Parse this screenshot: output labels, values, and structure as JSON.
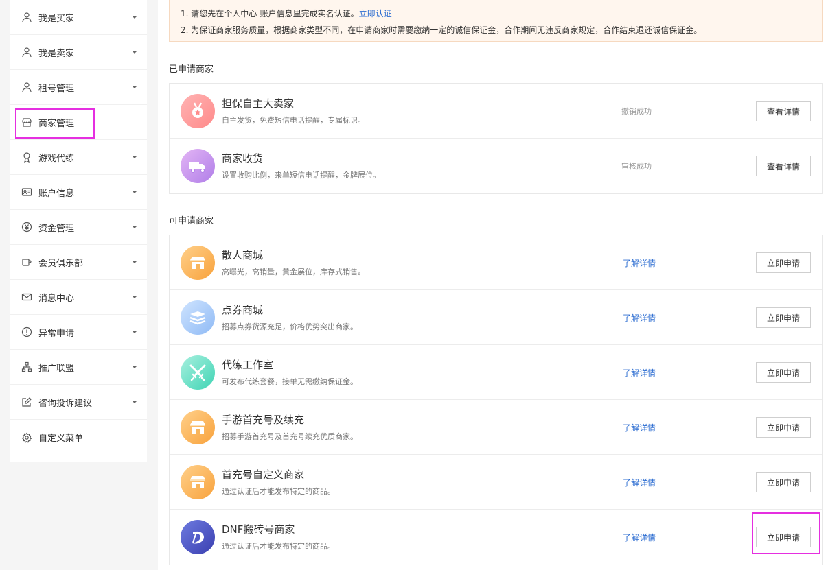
{
  "sidebar": {
    "items": [
      {
        "label": "我是买家",
        "icon": "user-icon",
        "caret": true
      },
      {
        "label": "我是卖家",
        "icon": "user-icon",
        "caret": true
      },
      {
        "label": "租号管理",
        "icon": "user-icon",
        "caret": true
      },
      {
        "label": "商家管理",
        "icon": "store-icon",
        "caret": false
      },
      {
        "label": "游戏代练",
        "icon": "trophy-icon",
        "caret": true
      },
      {
        "label": "账户信息",
        "icon": "id-card-icon",
        "caret": true
      },
      {
        "label": "资金管理",
        "icon": "yen-icon",
        "caret": true
      },
      {
        "label": "会员俱乐部",
        "icon": "cup-icon",
        "caret": true
      },
      {
        "label": "消息中心",
        "icon": "mail-icon",
        "caret": true
      },
      {
        "label": "异常申请",
        "icon": "alert-icon",
        "caret": true
      },
      {
        "label": "推广联盟",
        "icon": "org-chart-icon",
        "caret": true
      },
      {
        "label": "咨询投诉建议",
        "icon": "edit-icon",
        "caret": true
      },
      {
        "label": "自定义菜单",
        "icon": "gear-icon",
        "caret": false
      }
    ]
  },
  "notice": {
    "line1_text": "1. 请您先在个人中心-账户信息里完成实名认证。",
    "line1_link": "立即认证",
    "line2_text": "2. 为保证商家服务质量，根据商家类型不同，在申请商家时需要缴纳一定的诚信保证金，合作期间无违反商家规定，合作结束退还诚信保证金。"
  },
  "applied": {
    "title": "已申请商家",
    "items": [
      {
        "name": "担保自主大卖家",
        "desc": "自主发货，免费短信电话提醒，专属标识。",
        "status": "撤销成功",
        "button": "查看详情",
        "icon": "medal-icon"
      },
      {
        "name": "商家收货",
        "desc": "设置收购比例，来单短信电话提醒，金牌展位。",
        "status": "审核成功",
        "button": "查看详情",
        "icon": "truck-icon"
      }
    ]
  },
  "available": {
    "title": "可申请商家",
    "items": [
      {
        "name": "散人商城",
        "desc": "高曝光，高销量，黄金展位，库存式销售。",
        "link": "了解详情",
        "button": "立即申请",
        "icon": "shop-icon"
      },
      {
        "name": "点券商城",
        "desc": "招募点券货源充足，价格优势突出商家。",
        "link": "了解详情",
        "button": "立即申请",
        "icon": "layers-icon"
      },
      {
        "name": "代练工作室",
        "desc": "可发布代练套餐，接单无需缴纳保证金。",
        "link": "了解详情",
        "button": "立即申请",
        "icon": "crossed-swords-icon"
      },
      {
        "name": "手游首充号及续充",
        "desc": "招募手游首充号及首充号续充优质商家。",
        "link": "了解详情",
        "button": "立即申请",
        "icon": "shop-icon"
      },
      {
        "name": "首充号自定义商家",
        "desc": "通过认证后才能发布特定的商品。",
        "link": "了解详情",
        "button": "立即申请",
        "icon": "shop-icon"
      },
      {
        "name": "DNF搬砖号商家",
        "desc": "通过认证后才能发布特定的商品。",
        "link": "了解详情",
        "button": "立即申请",
        "icon": "dnf-logo-icon"
      }
    ]
  }
}
